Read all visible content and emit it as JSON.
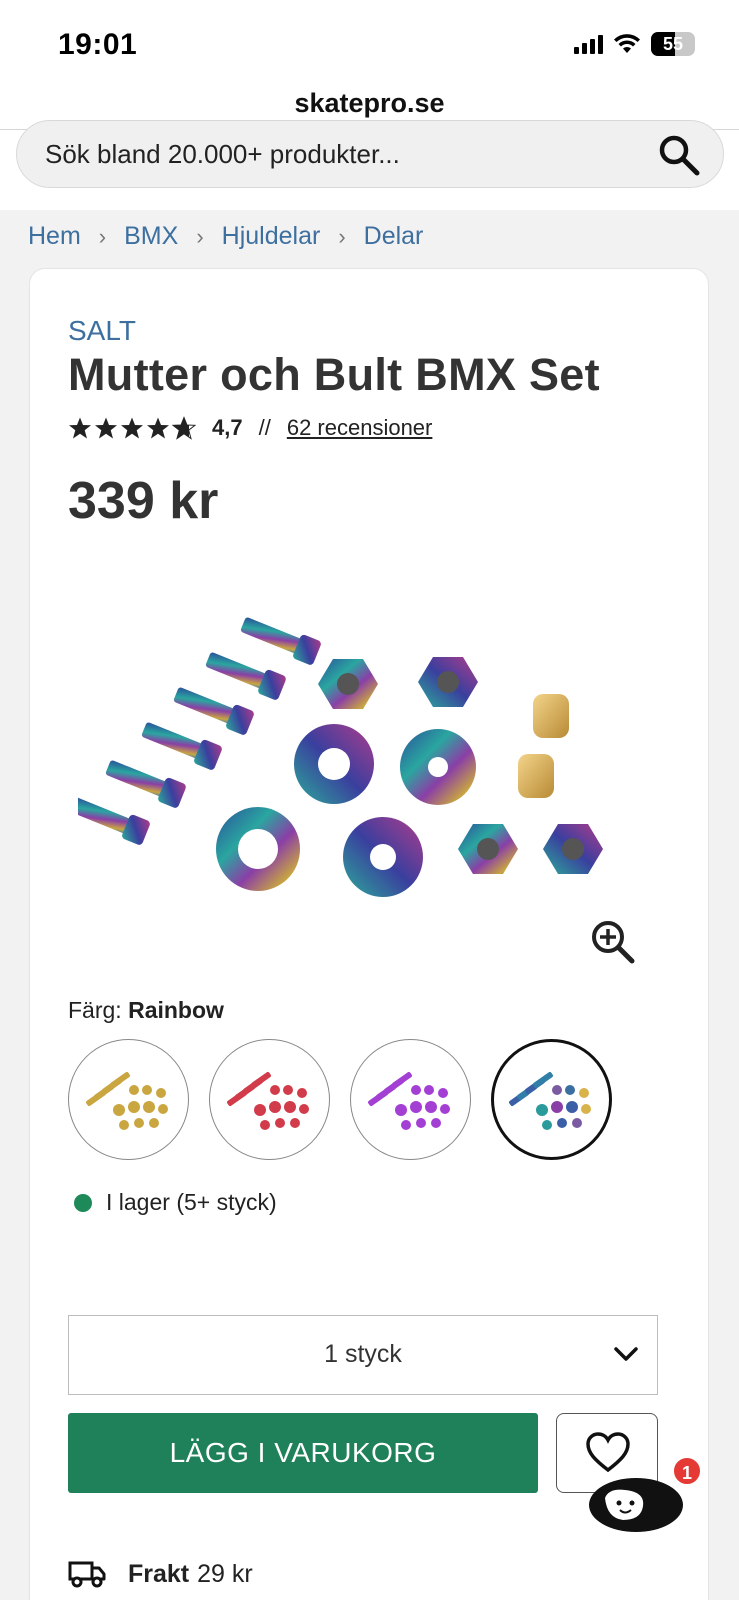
{
  "status_bar": {
    "time": "19:01",
    "battery": "55"
  },
  "browser": {
    "url": "skatepro.se"
  },
  "search": {
    "placeholder": "Sök bland 20.000+ produkter..."
  },
  "breadcrumb": [
    "Hem",
    "BMX",
    "Hjuldelar",
    "Delar"
  ],
  "product": {
    "brand": "SALT",
    "title": "Mutter och Bult BMX Set",
    "rating": "4,7",
    "rating_stars": 4.7,
    "rating_separator": "//",
    "reviews": "62 recensioner",
    "price": "339 kr"
  },
  "color": {
    "label": "Färg:",
    "selected": "Rainbow",
    "swatches": [
      "gold",
      "red",
      "purple",
      "rainbow"
    ]
  },
  "stock": {
    "text": "I lager (5+ styck)",
    "status_color": "#1e8a5a"
  },
  "quantity": {
    "selected": "1 styck"
  },
  "actions": {
    "add_to_cart": "LÄGG I VARUKORG"
  },
  "shipping": {
    "label": "Frakt",
    "value": "29 kr"
  },
  "chat": {
    "badge_count": "1"
  },
  "colors": {
    "accent": "#1f8159",
    "link": "#3d6f9f"
  }
}
